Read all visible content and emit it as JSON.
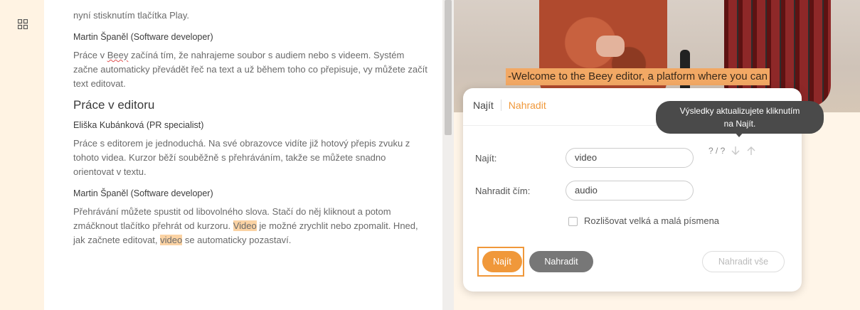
{
  "transcript": {
    "intro_line": "nyní stisknutím tlačítka Play.",
    "block1_speaker": "Martin Španěl (Software developer)",
    "block1_text_pre": "Práce v ",
    "block1_brand": "Beey",
    "block1_text_post": " začíná tím, že nahrajeme soubor s audiem nebo s videem. Systém začne automaticky převádět řeč na text a už během toho co přepisuje, vy můžete začít text editovat.",
    "section_title": "Práce v editoru",
    "block2_speaker": "Eliška Kubánková (PR specialist)",
    "block2_text": "Práce s editorem je jednoduchá. Na své obrazovce vidíte již hotový přepis zvuku z tohoto videa. Kurzor běží souběžně s přehráváním, takže se můžete snadno orientovat v textu.",
    "block3_speaker": "Martin Španěl (Software developer)",
    "block3_text_a": "Přehrávání můžete spustit od libovolného slova. Stačí do něj kliknout a potom zmáčknout tlačítko přehrát od kurzoru. ",
    "block3_hl1": "Video",
    "block3_text_b": " je možné zrychlit nebo zpomalit. Hned, jak začnete editovat, ",
    "block3_hl2": "video",
    "block3_text_c": " se automaticky pozastaví."
  },
  "video": {
    "caption": "-Welcome to the Beey editor, a platform where you can"
  },
  "dialog": {
    "tab_find": "Najít",
    "tab_replace": "Nahradit",
    "find_label": "Najít:",
    "find_value": "video",
    "replace_label": "Nahradit čím:",
    "replace_value": "audio",
    "counter": "? / ?",
    "case_label": "Rozlišovat velká a malá písmena",
    "btn_find": "Najít",
    "btn_replace": "Nahradit",
    "btn_replace_all": "Nahradit vše"
  },
  "tooltip": {
    "line1": "Výsledky aktualizujete kliknutím",
    "line2": "na Najít."
  },
  "colors": {
    "accent": "#f0983a",
    "highlight": "#fbd3a4",
    "tooltip_bg": "#4a4a4a"
  },
  "icons": [
    "grid-icon",
    "arrow-down-icon",
    "arrow-up-icon"
  ]
}
